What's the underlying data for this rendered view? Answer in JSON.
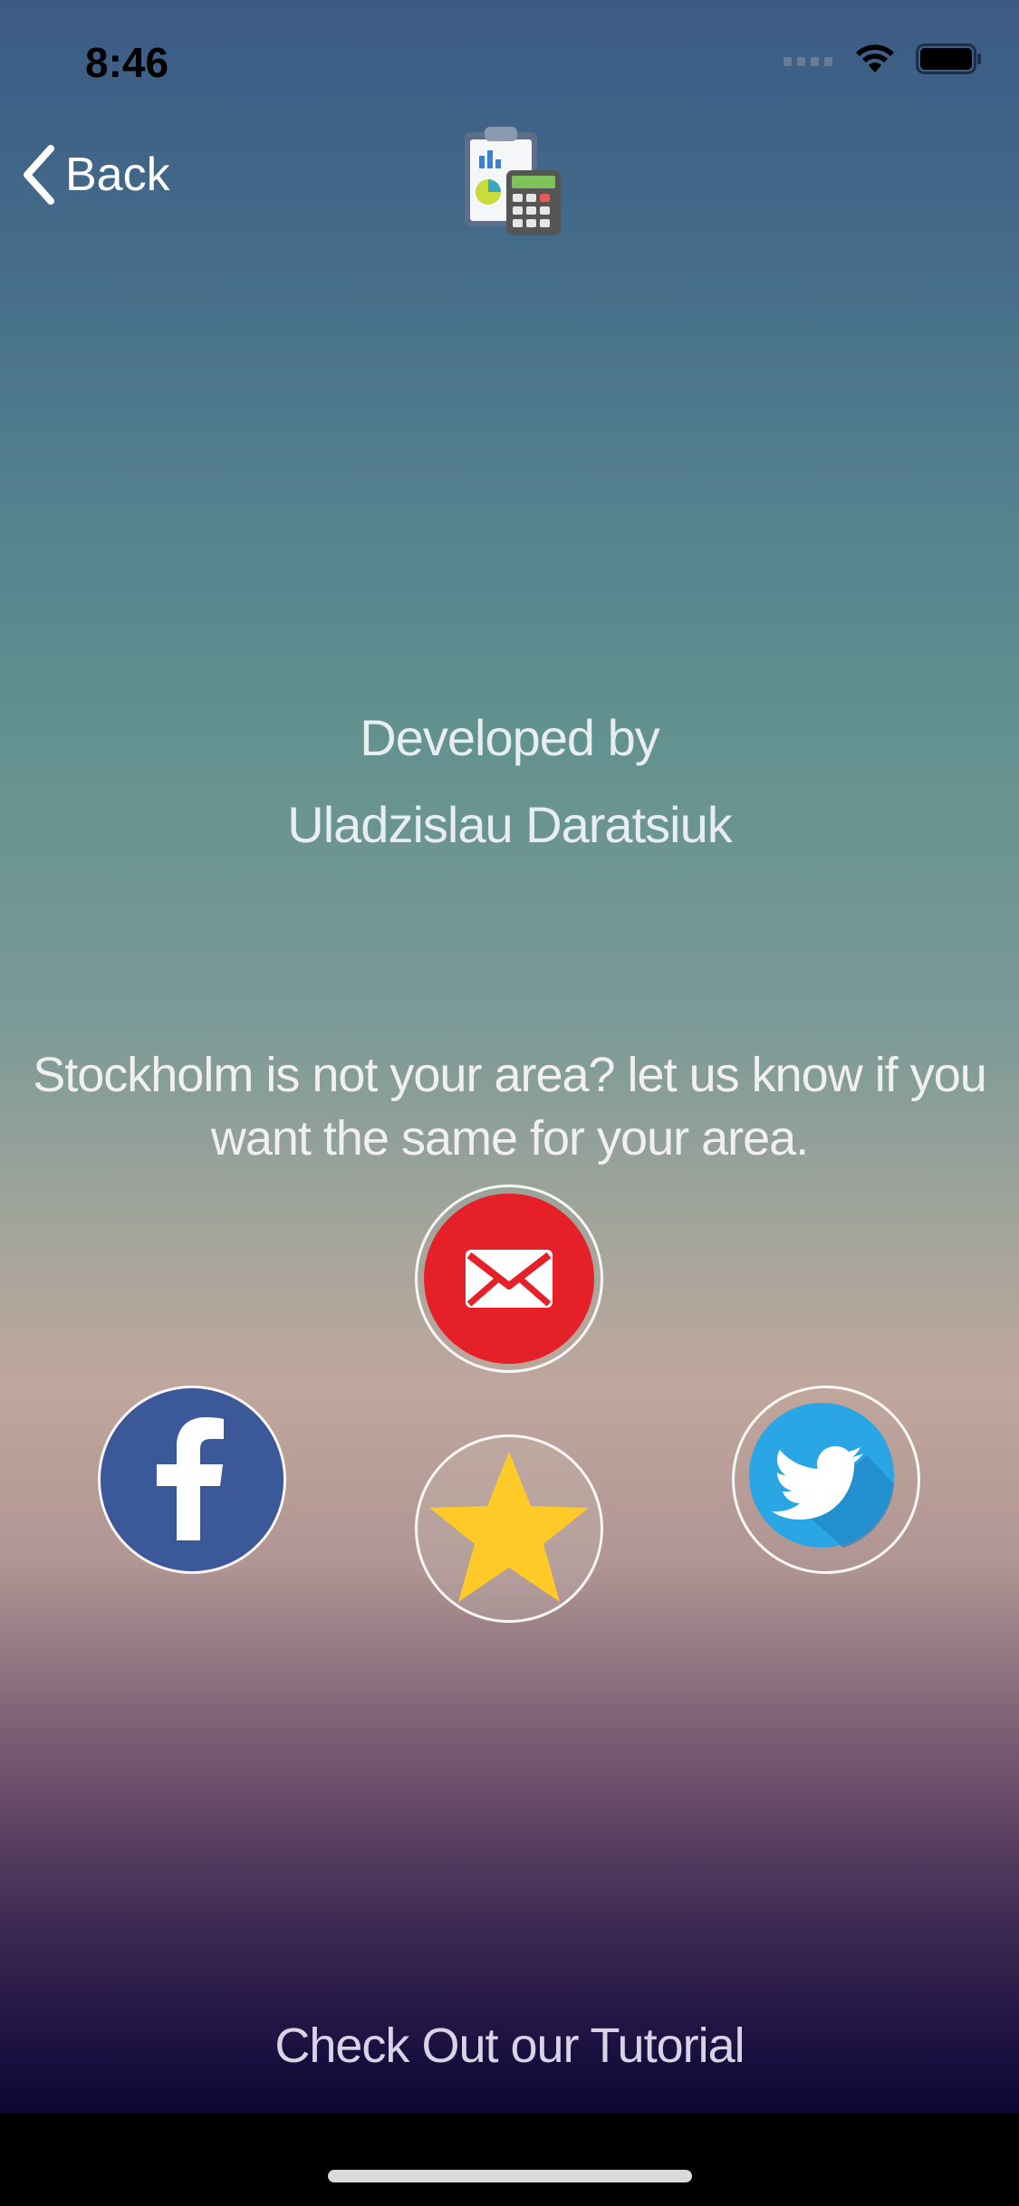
{
  "status_bar": {
    "time": "8:46"
  },
  "nav": {
    "back_label": "Back"
  },
  "credits": {
    "line1": "Developed by",
    "line2": "Uladzislau Daratsiuk"
  },
  "message": {
    "line1": "Stockholm is not your area? let us know if you",
    "line2": "want the same for your area."
  },
  "social": {
    "mail_icon": "mail-icon",
    "facebook_icon": "facebook-icon",
    "star_icon": "star-icon",
    "twitter_icon": "twitter-icon"
  },
  "colors": {
    "mail_red": "#e52029",
    "facebook_blue": "#3b5998",
    "star_yellow": "#ffc928",
    "twitter_blue": "#2aa6e4"
  },
  "footer": {
    "tutorial_label": "Check Out our Tutorial"
  }
}
